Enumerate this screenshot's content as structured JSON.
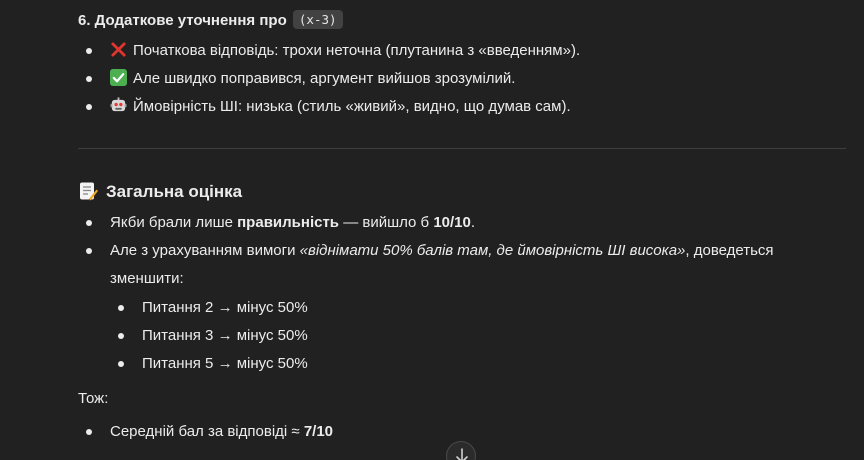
{
  "section6": {
    "heading_text": "6. Додаткове уточнення про",
    "heading_code": "(x-3)",
    "items": [
      {
        "icon": "cross-mark-icon",
        "text": "Початкова відповідь: трохи неточна (плутанина з «введенням»)."
      },
      {
        "icon": "check-mark-icon",
        "text": "Але швидко поправився, аргумент вийшов зрозумілий."
      },
      {
        "icon": "robot-icon",
        "text": "Ймовірність ШІ: низька (стиль «живий», видно, що думав сам)."
      }
    ]
  },
  "summary": {
    "heading_icon": "memo-icon",
    "heading": "Загальна оцінка",
    "item1": {
      "pre": "Якби брали лише ",
      "bold": "правильність",
      "mid": " — вийшло б ",
      "score": "10/10",
      "post": "."
    },
    "item2": {
      "pre": "Але з урахуванням вимоги ",
      "italic": "«віднімати 50% балів там, де ймовірність ШІ висока»",
      "post": ", доведеться",
      "line2": "зменшити:"
    },
    "subitems": [
      "Питання 2 → мінус 50%",
      "Питання 3 → мінус 50%",
      "Питання 5 → мінус 50%"
    ],
    "so_label": "Тож:",
    "final": {
      "pre": "Середній бал за відповіді ≈ ",
      "score": "7/10"
    }
  },
  "colors": {
    "background": "#212121",
    "text": "#ececec",
    "code_bg": "#424242",
    "divider": "#3f3f3f",
    "cross": "#e0342f",
    "check": "#4caf50"
  },
  "scroll_button": {
    "icon": "arrow-down-icon"
  }
}
